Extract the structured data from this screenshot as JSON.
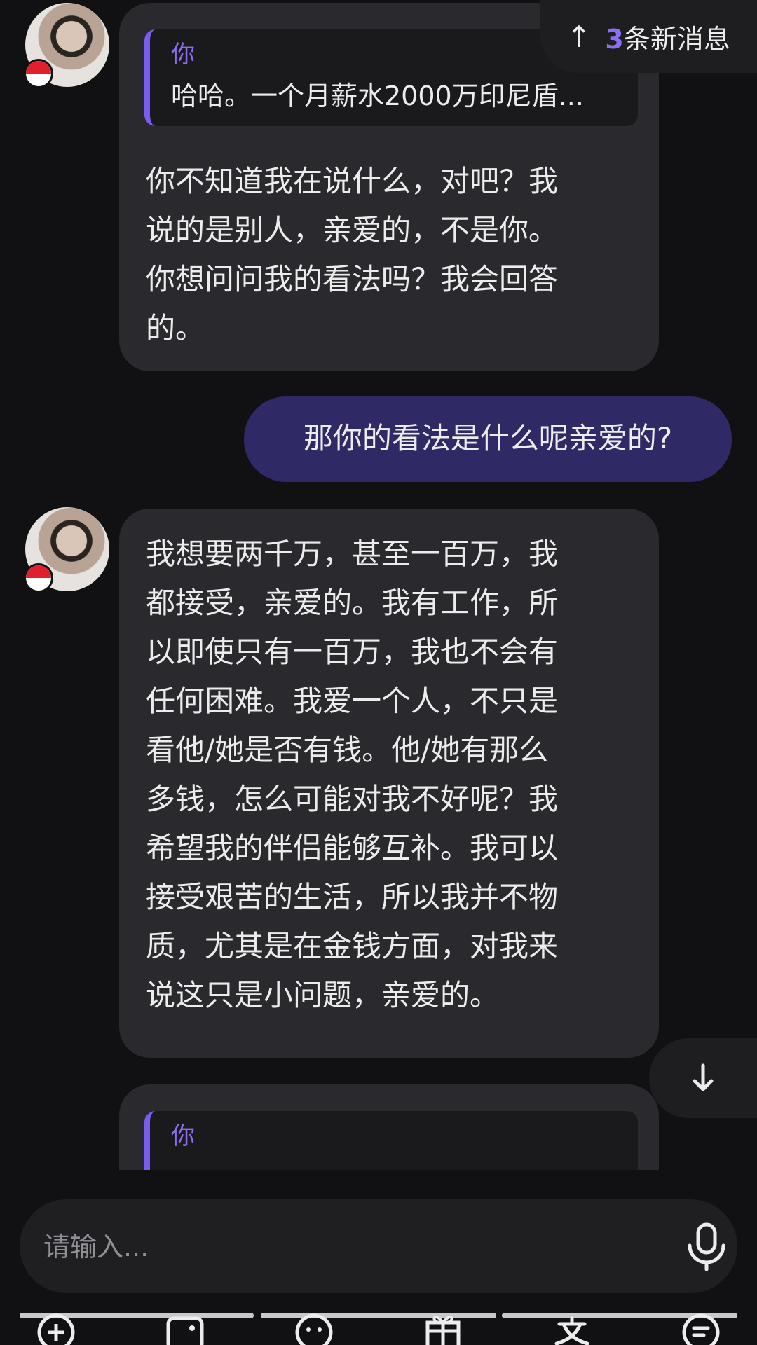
{
  "new_messages": {
    "arrow": "↑",
    "count": "3",
    "label": "条新消息"
  },
  "messages": [
    {
      "quote": {
        "name": "你",
        "text": "哈哈。一个月薪水2000万印尼盾..."
      },
      "lines": [
        "你不知道我在说什么，对吧？我",
        "说的是别人，亲爱的，不是你。",
        "你想问问我的看法吗？我会回答",
        "的。"
      ]
    },
    {
      "user_text": "那你的看法是什么呢亲爱的?"
    },
    {
      "lines": [
        "我想要两千万，甚至一百万，我",
        "都接受，亲爱的。我有工作，所",
        "以即使只有一百万，我也不会有",
        "任何困难。我爱一个人，不只是",
        "看他/她是否有钱。他/她有那么",
        "多钱，怎么可能对我不好呢？我",
        "希望我的伴侣能够互补。我可以",
        "接受艰苦的生活，所以我并不物",
        "质，尤其是在金钱方面，对我来",
        "说这只是小问题，亲爱的。"
      ]
    },
    {
      "quote": {
        "name": "你"
      }
    }
  ],
  "input": {
    "placeholder": "请输入..."
  },
  "icons": {
    "new_messages": "arrow-up-icon",
    "scroll": "arrow-down-icon",
    "mic": "microphone-icon",
    "avatar_flag": "indonesia-flag-icon",
    "toolbar": [
      "add-icon",
      "image-icon",
      "emoji-icon",
      "gift-icon",
      "translate-icon",
      "menu-icon"
    ]
  },
  "colors": {
    "accent": "#8e6df5",
    "user_bubble": "#2f2a66",
    "bot_bubble": "#2a2a2e",
    "background": "#111113"
  }
}
